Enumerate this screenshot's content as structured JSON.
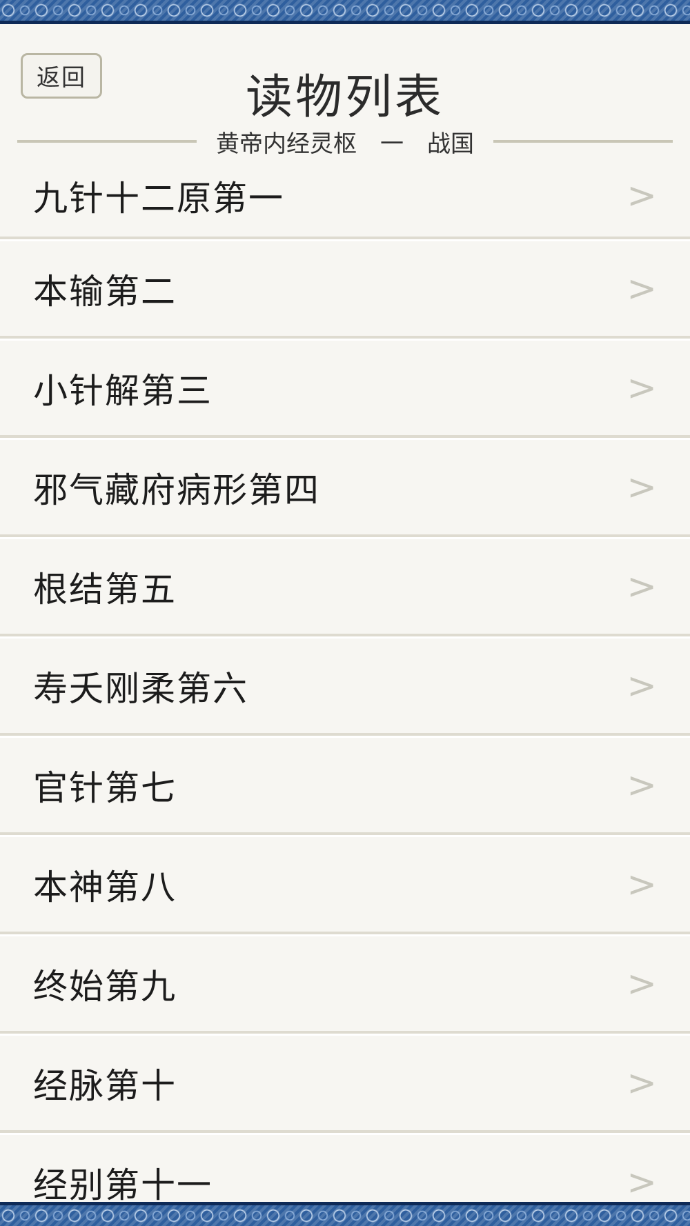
{
  "header": {
    "back_label": "返回",
    "title": "读物列表",
    "book": "黄帝内经灵枢",
    "separator": "一",
    "era": "战国"
  },
  "chapters": [
    {
      "label": "九针十二原第一",
      "icon": "chevron-right-icon",
      "glyph": ">"
    },
    {
      "label": "本输第二",
      "icon": "chevron-right-icon",
      "glyph": ">"
    },
    {
      "label": "小针解第三",
      "icon": "chevron-right-icon",
      "glyph": ">"
    },
    {
      "label": "邪气藏府病形第四",
      "icon": "chevron-right-icon",
      "glyph": ">"
    },
    {
      "label": "根结第五",
      "icon": "chevron-right-icon",
      "glyph": ">"
    },
    {
      "label": "寿夭刚柔第六",
      "icon": "chevron-right-icon",
      "glyph": ">"
    },
    {
      "label": "官针第七",
      "icon": "chevron-right-icon",
      "glyph": ">"
    },
    {
      "label": "本神第八",
      "icon": "chevron-right-icon",
      "glyph": ">"
    },
    {
      "label": "终始第九",
      "icon": "chevron-right-icon",
      "glyph": ">"
    },
    {
      "label": "经脉第十",
      "icon": "chevron-right-icon",
      "glyph": ">"
    },
    {
      "label": "经别第十一",
      "icon": "chevron-right-icon",
      "glyph": ">"
    }
  ],
  "colors": {
    "background": "#f7f6f2",
    "border_blue": "#2f5f9e",
    "border_dark": "#0e2a57",
    "chevron": "#c8c7bd"
  }
}
